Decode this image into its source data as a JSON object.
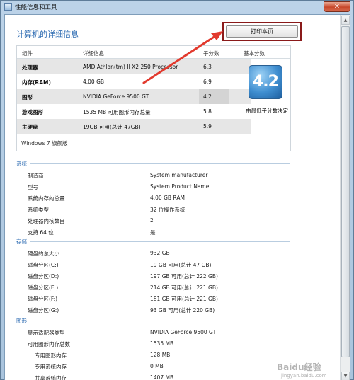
{
  "window": {
    "title": "性能信息和工具",
    "close_label": "✕"
  },
  "page": {
    "title": "计算机的详细信息",
    "print_label": "打印本页"
  },
  "score_table": {
    "headers": {
      "component": "组件",
      "detail": "详细信息",
      "subscore": "子分数",
      "base": "基本分数"
    },
    "rows": [
      {
        "component": "处理器",
        "detail": "AMD Athlon(tm) II X2 250 Processor",
        "score": "6.3"
      },
      {
        "component": "内存(RAM)",
        "detail": "4.00 GB",
        "score": "6.9"
      },
      {
        "component": "图形",
        "detail": "NVIDIA GeForce 9500 GT",
        "score": "4.2"
      },
      {
        "component": "游戏图形",
        "detail": "1535 MB 可用图形内存总量",
        "score": "5.8"
      },
      {
        "component": "主硬盘",
        "detail": "19GB 可用(总计 47GB)",
        "score": "5.9"
      }
    ],
    "base_score": "4.2",
    "base_caption": "由最低子分数决定",
    "edition": "Windows 7 旗舰版"
  },
  "sections": {
    "system": {
      "title": "系统",
      "rows": [
        {
          "label": "制造商",
          "value": "System manufacturer"
        },
        {
          "label": "型号",
          "value": "System Product Name"
        },
        {
          "label": "系统内存的总量",
          "value": "4.00 GB RAM"
        },
        {
          "label": "系统类型",
          "value": "32 位操作系统"
        },
        {
          "label": "处理器内核数目",
          "value": "2"
        },
        {
          "label": "支持 64 位",
          "value": "是"
        }
      ]
    },
    "storage": {
      "title": "存储",
      "rows": [
        {
          "label": "硬盘的总大小",
          "value": "932 GB"
        },
        {
          "label": "磁盘分区(C:)",
          "value": "19 GB 可用(总计 47 GB)"
        },
        {
          "label": "磁盘分区(D:)",
          "value": "197 GB 可用(总计 222 GB)"
        },
        {
          "label": "磁盘分区(E:)",
          "value": "214 GB 可用(总计 221 GB)"
        },
        {
          "label": "磁盘分区(F:)",
          "value": "181 GB 可用(总计 221 GB)"
        },
        {
          "label": "磁盘分区(G:)",
          "value": "93 GB 可用(总计 220 GB)"
        }
      ]
    },
    "graphics": {
      "title": "图形",
      "rows": [
        {
          "label": "显示适配器类型",
          "value": "NVIDIA GeForce 9500 GT"
        },
        {
          "label": "可用图形内存总数",
          "value": "1535 MB"
        },
        {
          "label": "专用图形内存",
          "value": "128 MB"
        },
        {
          "label": "专用系统内存",
          "value": "0 MB"
        },
        {
          "label": "共享系统内存",
          "value": "1407 MB"
        }
      ]
    }
  },
  "watermark": {
    "main": "Baidu经验",
    "sub": "jingyan.baidu.com"
  },
  "colors": {
    "accent": "#2f6db3",
    "highlight_border": "#8a1a1a",
    "arrow": "#e23a2e"
  },
  "icons": {
    "scroll_up": "▲",
    "scroll_down": "▼"
  }
}
